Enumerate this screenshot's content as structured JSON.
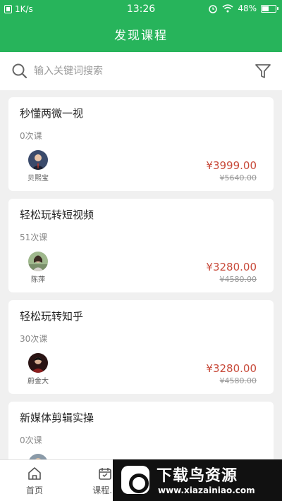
{
  "status_bar": {
    "network_speed": "1K/s",
    "time": "13:26",
    "battery": "48%"
  },
  "header": {
    "title": "发现课程"
  },
  "search": {
    "placeholder": "输入关键词搜索"
  },
  "courses": [
    {
      "title": "秒懂两微一视",
      "lessons": "0次课",
      "teacher": "贝熙宝",
      "price": "¥3999.00",
      "original_price": "¥5640.00"
    },
    {
      "title": "轻松玩转短视频",
      "lessons": "51次课",
      "teacher": "陈萍",
      "price": "¥3280.00",
      "original_price": "¥4580.00"
    },
    {
      "title": "轻松玩转知乎",
      "lessons": "30次课",
      "teacher": "蔚金大",
      "price": "¥3280.00",
      "original_price": "¥4580.00"
    },
    {
      "title": "新媒体剪辑实操",
      "lessons": "0次课"
    }
  ],
  "tabs": [
    {
      "label": "首页"
    },
    {
      "label": "课程..."
    }
  ],
  "watermark": {
    "title": "下载鸟资源",
    "url": "www.xiazainiao.com"
  }
}
